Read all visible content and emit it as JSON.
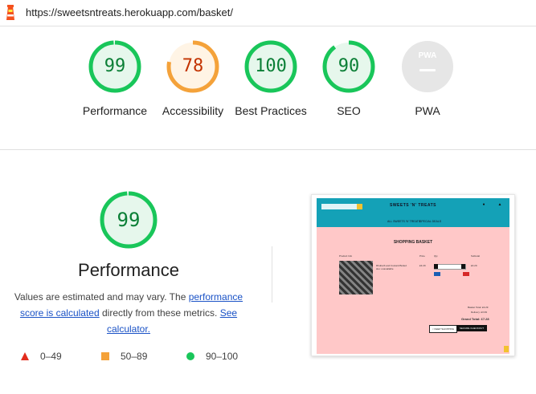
{
  "header": {
    "url": "https://sweetsntreats.herokuapp.com/basket/"
  },
  "colors": {
    "pass": "#0b7f36",
    "pass_ring": "#19c65a",
    "pass_bg": "#e6f7ec",
    "average": "#c33300",
    "average_ring": "#f4a23a",
    "average_bg": "#fff4e5",
    "fail": "#e22c1d",
    "pwa_bg": "#e6e6e6",
    "link": "#1a52c6"
  },
  "scores": [
    {
      "value": 99,
      "label": "Performance",
      "rating": "pass"
    },
    {
      "value": 78,
      "label": "Accessibility",
      "rating": "average"
    },
    {
      "value": 100,
      "label": "Best Practices",
      "rating": "pass"
    },
    {
      "value": 90,
      "label": "SEO",
      "rating": "pass"
    }
  ],
  "pwa": {
    "badge": "PWA",
    "label": "PWA"
  },
  "performance": {
    "score": "99",
    "title": "Performance",
    "desc_before": "Values are estimated and may vary. The ",
    "desc_link1": "performance score is calculated",
    "desc_middle": " directly from these metrics. ",
    "desc_link2": "See calculator."
  },
  "legend": {
    "fail": "0–49",
    "average": "50–89",
    "pass": "90–100"
  },
  "thumbnail": {
    "brand": "SWEETS 'N' TREATS",
    "nav": [
      "ALL SWEETS 'N' TREATS",
      "SPECIAL DEALS"
    ],
    "title": "SHOPPING BASKET",
    "col_product": "Product Info",
    "col_price": "Price",
    "col_qty": "Qty",
    "col_subtotal": "Subtotal",
    "product_name": "Rhubarb and Custard Boiled",
    "product_sku": "sku: unavailable",
    "price": "£3.29",
    "subtotal": "£3.29",
    "basket_total": "Basket Total: £3.29",
    "delivery": "Delivery: £3.99",
    "grand_total": "Grand Total: £7.28",
    "keep_shopping": "< KEEP SHOPPING",
    "checkout": "SECURE CHECKOUT"
  }
}
